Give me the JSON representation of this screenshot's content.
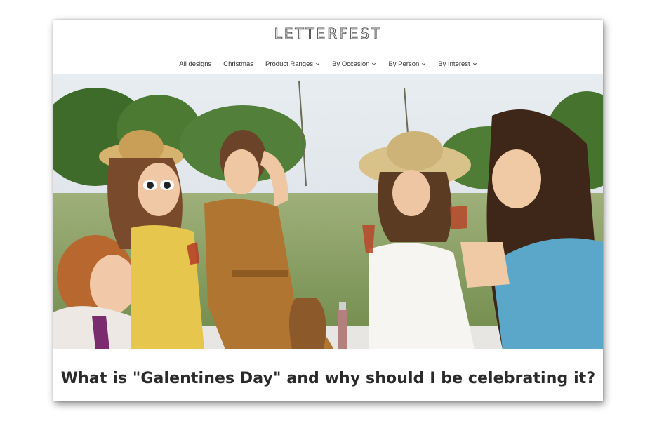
{
  "site": {
    "logo_text": "LETTERFEST"
  },
  "nav": {
    "items": [
      {
        "label": "All designs",
        "has_dropdown": false
      },
      {
        "label": "Christmas",
        "has_dropdown": false
      },
      {
        "label": "Product Ranges",
        "has_dropdown": true
      },
      {
        "label": "By Occasion",
        "has_dropdown": true
      },
      {
        "label": "By Person",
        "has_dropdown": true
      },
      {
        "label": "By Interest",
        "has_dropdown": true
      }
    ]
  },
  "hero": {
    "image_icon": "hero-photo"
  },
  "article": {
    "title": "What is \"Galentines Day\" and why should I be celebrating it?"
  },
  "colors": {
    "text": "#2a2a2a",
    "nav_text": "#333333",
    "logo_outline": "#555555"
  }
}
